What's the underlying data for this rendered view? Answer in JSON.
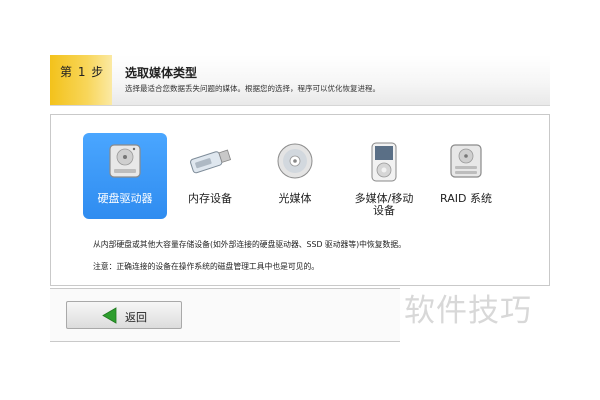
{
  "step": {
    "badge": "第 1 步",
    "title": "选取媒体类型",
    "description": "选择最适合您数据丢失问题的媒体。根据您的选择，程序可以优化恢复进程。"
  },
  "media_types": [
    {
      "label": "硬盘驱动器",
      "icon": "hard-drive-icon",
      "selected": true
    },
    {
      "label": "内存设备",
      "icon": "usb-drive-icon",
      "selected": false
    },
    {
      "label": "光媒体",
      "icon": "optical-disc-icon",
      "selected": false
    },
    {
      "label": "多媒体/移动设备",
      "label_line1": "多媒体/移动",
      "label_line2": "设备",
      "icon": "media-player-icon",
      "selected": false
    },
    {
      "label": "RAID 系统",
      "icon": "raid-drive-icon",
      "selected": false
    }
  ],
  "info": {
    "line1": "从内部硬盘或其他大容量存储设备(如外部连接的硬盘驱动器、SSD 驱动器等)中恢复数据。",
    "line2": "注意：正确连接的设备在操作系统的磁盘管理工具中也是可见的。"
  },
  "footer": {
    "back_label": "返回"
  },
  "watermark": "软件技巧",
  "colors": {
    "accent_selected": "#3399ff",
    "step_badge": "#f3c21b",
    "back_arrow": "#2e9e2e"
  }
}
